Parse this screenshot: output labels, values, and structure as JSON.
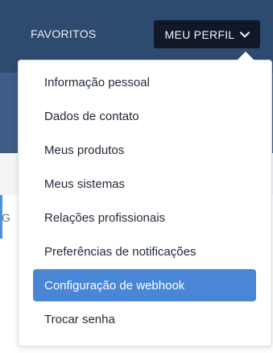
{
  "header": {
    "favorites_label": "FAVORITOS",
    "profile_button_label": "MEU PERFIL"
  },
  "menu": {
    "items": [
      {
        "label": "Informação pessoal",
        "active": false
      },
      {
        "label": "Dados de contato",
        "active": false
      },
      {
        "label": "Meus produtos",
        "active": false
      },
      {
        "label": "Meus sistemas",
        "active": false
      },
      {
        "label": "Relações profissionais",
        "active": false
      },
      {
        "label": "Preferências de notificações",
        "active": false
      },
      {
        "label": "Configuração de webhook",
        "active": true
      },
      {
        "label": "Trocar senha",
        "active": false
      }
    ]
  },
  "colors": {
    "header_bg": "#2f4a6f",
    "profile_button_bg": "#111827",
    "active_item_bg": "#4a86d6",
    "text_dark": "#1f2937"
  },
  "icons": {
    "profile_chevron": "chevron-down-icon"
  }
}
